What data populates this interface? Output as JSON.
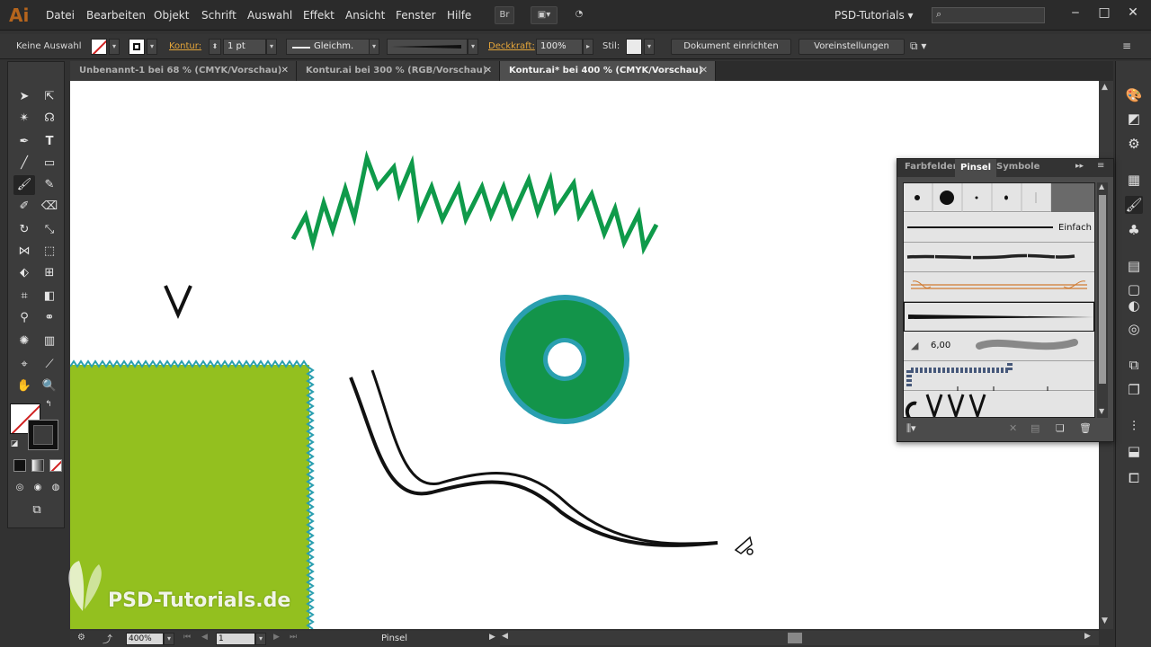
{
  "app": {
    "logo": "Ai",
    "workspace": "PSD-Tutorials"
  },
  "menu": [
    "Datei",
    "Bearbeiten",
    "Objekt",
    "Schrift",
    "Auswahl",
    "Effekt",
    "Ansicht",
    "Fenster",
    "Hilfe"
  ],
  "menubar_buttons": {
    "bridge": "Br"
  },
  "control": {
    "selection": "Keine Auswahl",
    "stroke_label": "Kontur:",
    "stroke_weight": "1 pt",
    "stroke_profile": "Gleichm.",
    "opacity_label": "Deckkraft:",
    "opacity_value": "100%",
    "style_label": "Stil:",
    "doc_setup": "Dokument einrichten",
    "preferences": "Voreinstellungen"
  },
  "tabs": [
    {
      "label": "Unbenannt-1 bei 68 % (CMYK/Vorschau)",
      "active": false
    },
    {
      "label": "Kontur.ai bei 300 % (RGB/Vorschau)",
      "active": false
    },
    {
      "label": "Kontur.ai* bei 400 % (CMYK/Vorschau)",
      "active": true
    }
  ],
  "status": {
    "zoom": "400%",
    "artboard": "1",
    "tool": "Pinsel"
  },
  "brush_panel": {
    "tabs": [
      "Farbfelder",
      "Pinsel",
      "Symbole"
    ],
    "active_tab": "Pinsel",
    "basic_label": "Einfach",
    "brush_size": "6,00"
  },
  "watermark": "PSD-Tutorials.de",
  "colors": {
    "ui_dark": "#323232",
    "accent_orange": "#e4a53a",
    "green_zigzag": "#0f9a4a",
    "teal_ring": "#2a9fb0",
    "lime_rect": "#93c01f",
    "stroke_red": "#d02020"
  }
}
